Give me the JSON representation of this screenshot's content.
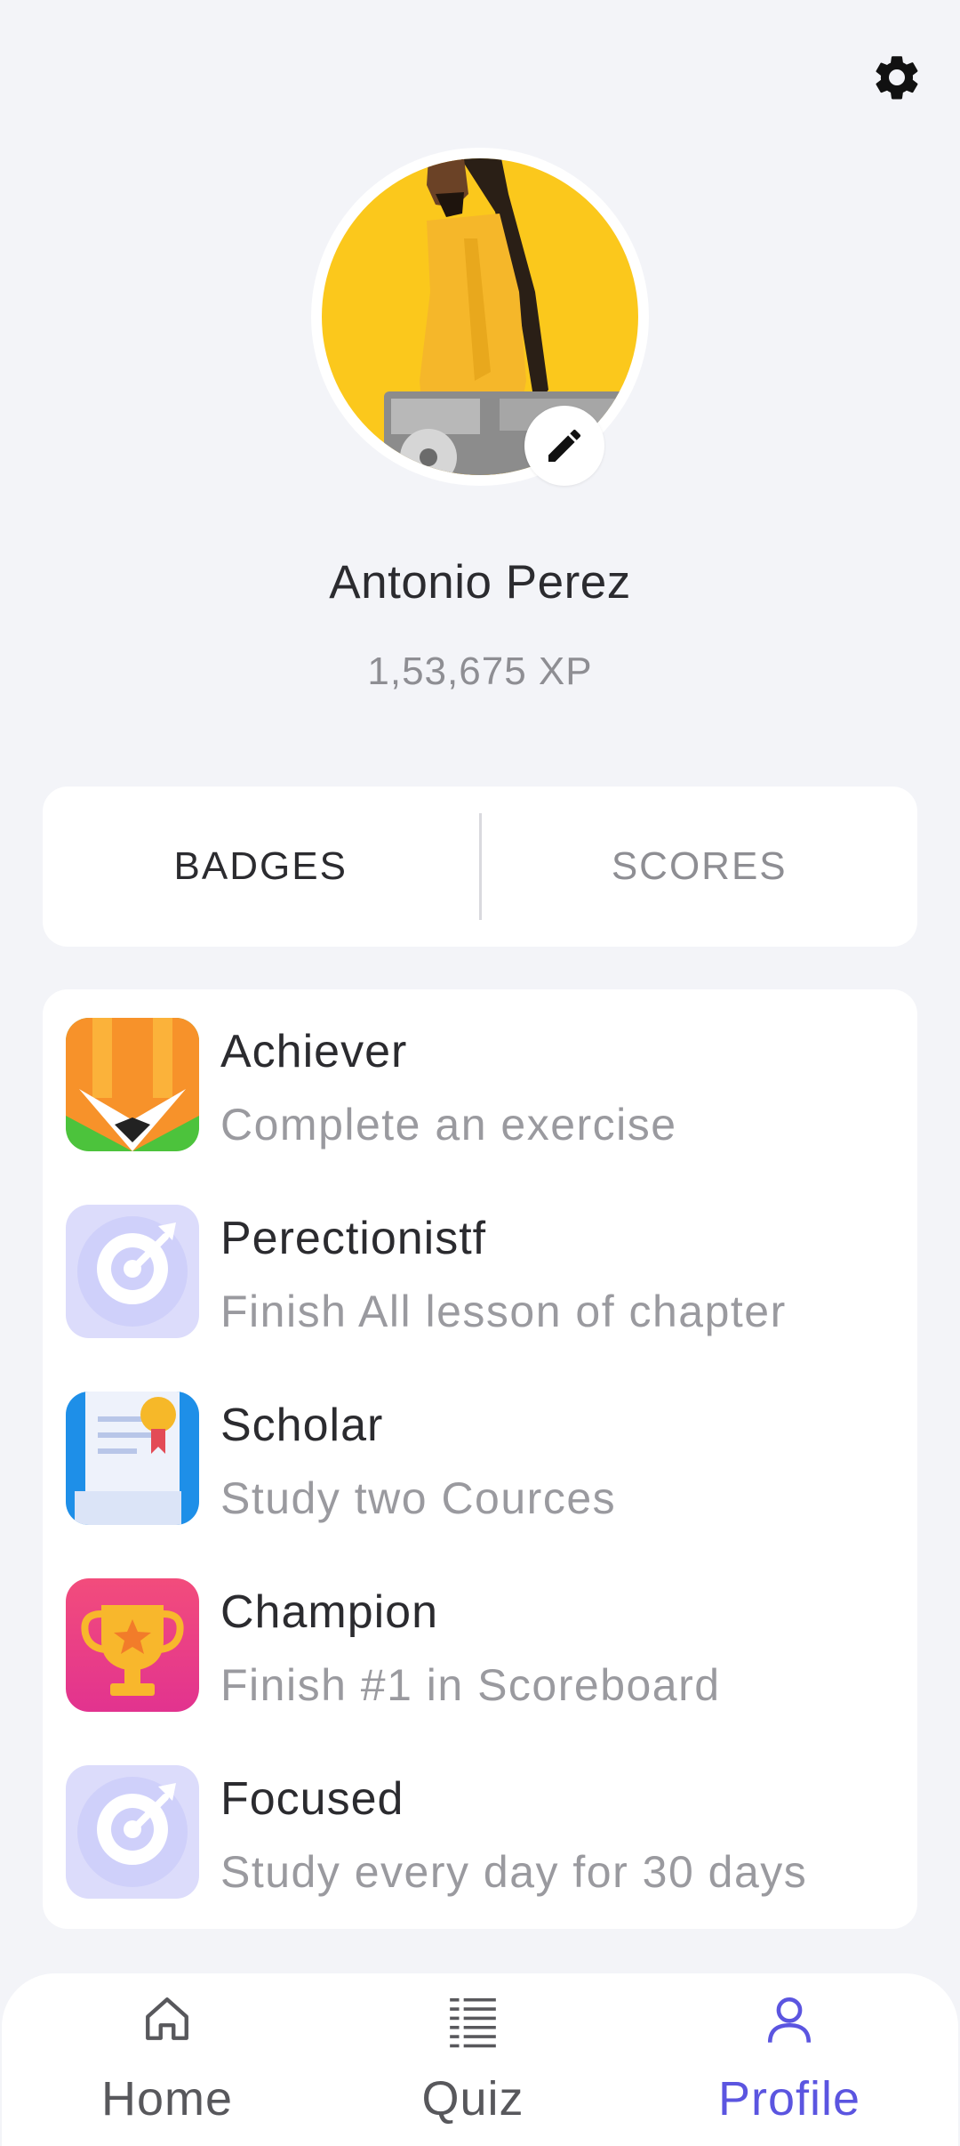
{
  "header": {
    "settings_icon": "gear-icon"
  },
  "profile": {
    "name": "Antonio Perez",
    "xp": "1,53,675 XP",
    "avatar_description": "person in yellow shirt holding DJ controller on yellow background",
    "edit_icon": "pencil-icon"
  },
  "tabs": [
    {
      "label": "BADGES",
      "active": true
    },
    {
      "label": "SCORES",
      "active": false
    }
  ],
  "badges": [
    {
      "title": "Achiever",
      "description": "Complete an exercise",
      "icon": "pencil-badge-icon"
    },
    {
      "title": "Perectionistf",
      "description": "Finish All lesson of chapter",
      "icon": "target-badge-icon"
    },
    {
      "title": "Scholar",
      "description": "Study two Cources",
      "icon": "certificate-badge-icon"
    },
    {
      "title": "Champion",
      "description": "Finish #1 in Scoreboard",
      "icon": "trophy-badge-icon"
    },
    {
      "title": "Focused",
      "description": "Study every day for 30 days",
      "icon": "target-badge-icon"
    }
  ],
  "nav": [
    {
      "label": "Home",
      "icon": "home-icon",
      "active": false
    },
    {
      "label": "Quiz",
      "icon": "list-icon",
      "active": false
    },
    {
      "label": "Profile",
      "icon": "user-icon",
      "active": true
    }
  ],
  "colors": {
    "background": "#f3f4f8",
    "accent": "#5b55e0",
    "text_primary": "#2b2b2f",
    "text_secondary": "#8e8e93"
  }
}
